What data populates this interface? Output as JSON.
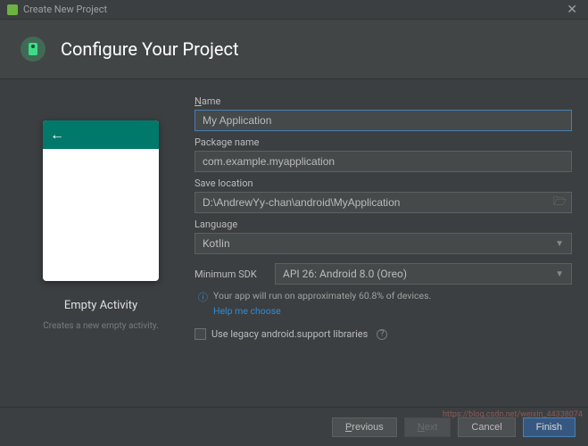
{
  "titlebar": {
    "title": "Create New Project"
  },
  "header": {
    "title": "Configure Your Project"
  },
  "preview": {
    "name": "Empty Activity",
    "desc": "Creates a new empty activity."
  },
  "form": {
    "name_label": "Name",
    "name_value": "My Application",
    "package_label": "Package name",
    "package_value": "com.example.myapplication",
    "location_label": "Save location",
    "location_value": "D:\\AndrewYy-chan\\android\\MyApplication",
    "language_label": "Language",
    "language_value": "Kotlin",
    "sdk_label": "Minimum SDK",
    "sdk_value": "API 26: Android 8.0 (Oreo)",
    "info_text": "Your app will run on approximately 60.8% of devices.",
    "info_link": "Help me choose",
    "legacy_label": "Use legacy android.support libraries"
  },
  "footer": {
    "previous": "Previous",
    "next": "Next",
    "cancel": "Cancel",
    "finish": "Finish"
  },
  "watermark": "https://blog.csdn.net/weixin_44338074"
}
